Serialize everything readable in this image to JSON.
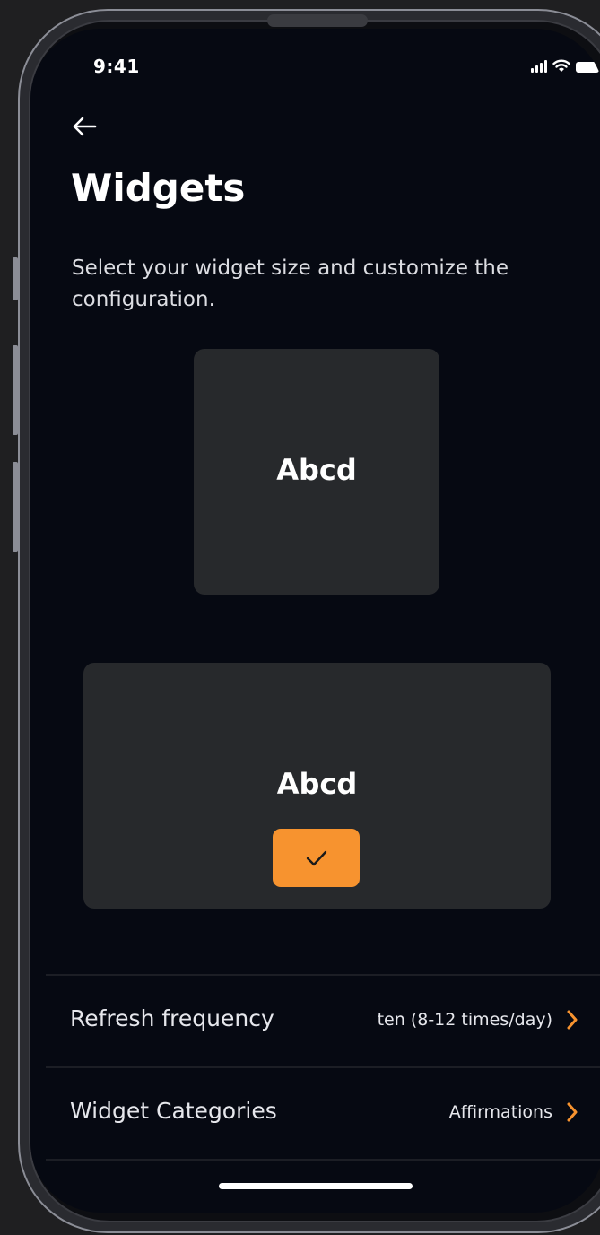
{
  "status_bar": {
    "time": "9:41"
  },
  "header": {
    "back_icon": "arrow-left-icon",
    "title": "Widgets"
  },
  "description": "Select your widget size and customize the configuration.",
  "widgets": {
    "small": {
      "label": "Abcd",
      "selected": false
    },
    "large": {
      "label": "Abcd",
      "selected": true,
      "check_icon": "checkmark-icon"
    }
  },
  "settings": [
    {
      "label": "Refresh frequency",
      "value": "ten (8-12 times/day)",
      "icon": "chevron-right-icon"
    },
    {
      "label": "Widget Categories",
      "value": "Affirmations",
      "icon": "chevron-right-icon"
    }
  ],
  "colors": {
    "accent": "#f7932f",
    "background": "#060912",
    "card": "#27292c",
    "text": "#ffffff"
  }
}
